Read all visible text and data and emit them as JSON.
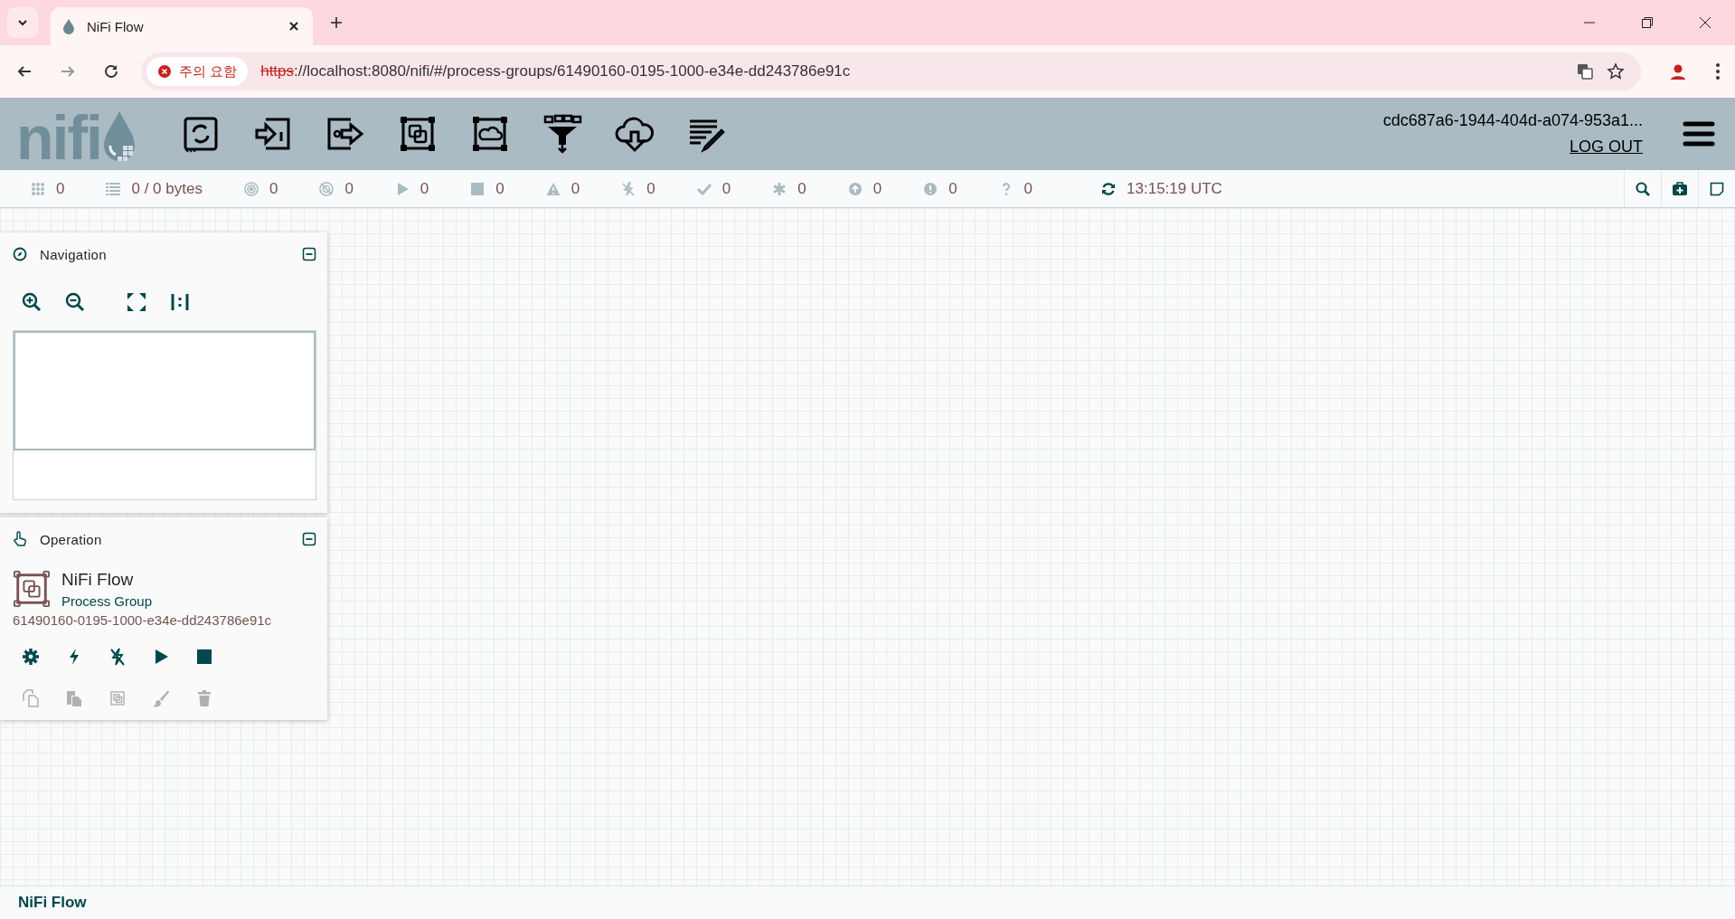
{
  "browser": {
    "tab_title": "NiFi Flow",
    "security_warning": "주의 요함",
    "url_scheme": "https",
    "url_rest": "://localhost:8080/nifi/#/process-groups/61490160-0195-1000-e34e-dd243786e91c"
  },
  "header": {
    "logo_text": "nifi",
    "user": "cdc687a6-1944-404d-a074-953a1...",
    "logout": "LOG OUT",
    "tools": [
      {
        "kind": "processor"
      },
      {
        "kind": "input-port"
      },
      {
        "kind": "output-port"
      },
      {
        "kind": "process-group"
      },
      {
        "kind": "remote-group"
      },
      {
        "kind": "funnel"
      },
      {
        "kind": "template"
      },
      {
        "kind": "label"
      }
    ]
  },
  "status_bar": {
    "items": [
      {
        "kind": "cluster",
        "value": "0"
      },
      {
        "kind": "queued",
        "value": "0 / 0 bytes"
      },
      {
        "kind": "transmitting",
        "value": "0"
      },
      {
        "kind": "not-transmitting",
        "value": "0"
      },
      {
        "kind": "running",
        "value": "0"
      },
      {
        "kind": "stopped",
        "value": "0"
      },
      {
        "kind": "invalid",
        "value": "0"
      },
      {
        "kind": "disabled",
        "value": "0"
      },
      {
        "kind": "up-to-date",
        "value": "0"
      },
      {
        "kind": "modified",
        "value": "0"
      },
      {
        "kind": "stale",
        "value": "0"
      },
      {
        "kind": "sync-failure",
        "value": "0"
      },
      {
        "kind": "unknown",
        "value": "0"
      }
    ],
    "refreshed": "13:15:19 UTC"
  },
  "navigation": {
    "title": "Navigation"
  },
  "operation": {
    "title": "Operation",
    "name": "NiFi Flow",
    "type": "Process Group",
    "id": "61490160-0195-1000-e34e-dd243786e91c",
    "actions": [
      {
        "kind": "configure",
        "disabled": false
      },
      {
        "kind": "enable",
        "disabled": false
      },
      {
        "kind": "disable",
        "disabled": false
      },
      {
        "kind": "start",
        "disabled": false
      },
      {
        "kind": "stop",
        "disabled": false
      }
    ],
    "edit_actions": [
      {
        "kind": "copy",
        "disabled": true
      },
      {
        "kind": "paste",
        "disabled": true
      },
      {
        "kind": "group",
        "disabled": true
      },
      {
        "kind": "color",
        "disabled": true
      },
      {
        "kind": "delete",
        "disabled": true
      }
    ]
  },
  "breadcrumb": "NiFi Flow"
}
